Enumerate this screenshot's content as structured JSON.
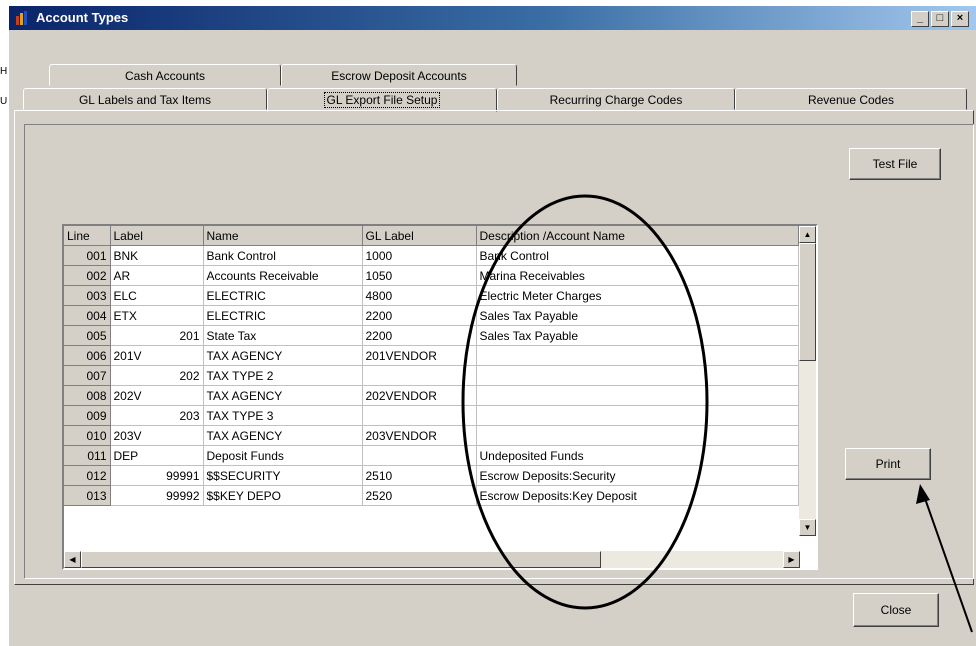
{
  "window": {
    "title": "Account Types",
    "controls": [
      "_",
      "□",
      "×"
    ]
  },
  "tabs_top": [
    "Cash Accounts",
    "Escrow Deposit Accounts"
  ],
  "tabs_bottom": [
    "GL Labels and Tax Items",
    "GL Export File Setup",
    "Recurring Charge Codes",
    "Revenue Codes"
  ],
  "buttons": {
    "test_file": "Test File",
    "print": "Print",
    "close": "Close"
  },
  "table": {
    "headers": [
      "Line",
      "Label",
      "Name",
      "GL Label",
      "Description /Account Name"
    ],
    "rows": [
      [
        "001",
        "BNK",
        "Bank Control",
        "1000",
        "Bank Control"
      ],
      [
        "002",
        "AR",
        "Accounts Receivable",
        "1050",
        "Marina Receivables"
      ],
      [
        "003",
        "ELC",
        "ELECTRIC",
        "4800",
        "Electric Meter Charges"
      ],
      [
        "004",
        "ETX",
        "ELECTRIC",
        "2200",
        "Sales Tax Payable"
      ],
      [
        "005",
        "201",
        "State Tax",
        "2200",
        "Sales Tax Payable"
      ],
      [
        "006",
        "201V",
        "TAX AGENCY",
        "201VENDOR",
        ""
      ],
      [
        "007",
        "202",
        "TAX TYPE 2",
        "",
        ""
      ],
      [
        "008",
        "202V",
        "TAX AGENCY",
        "202VENDOR",
        ""
      ],
      [
        "009",
        "203",
        "TAX TYPE 3",
        "",
        ""
      ],
      [
        "010",
        "203V",
        "TAX AGENCY",
        "203VENDOR",
        ""
      ],
      [
        "011",
        "DEP",
        "Deposit Funds",
        "",
        "Undeposited Funds"
      ],
      [
        "012",
        "99991",
        "$$SECURITY",
        "2510",
        "Escrow Deposits:Security"
      ],
      [
        "013",
        "99992",
        "$$KEY DEPO",
        "2520",
        "Escrow Deposits:Key Deposit"
      ]
    ]
  },
  "left_strip_chars": [
    "H",
    "U"
  ]
}
